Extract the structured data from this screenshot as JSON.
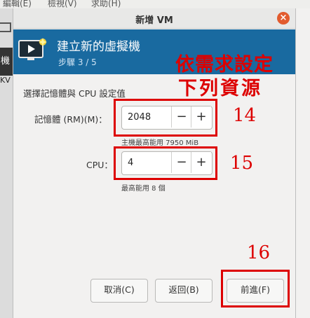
{
  "background": {
    "menu_items": [
      "編輯(E)",
      "檢視(V)",
      "求助(H)"
    ],
    "left_tab_label": "機",
    "left_sub_label": "KV"
  },
  "dialog": {
    "title": "新增 VM",
    "close_glyph": "×"
  },
  "header": {
    "title": "建立新的虛擬機",
    "step": "步驟 3 / 5",
    "icon": "monitor-play-icon"
  },
  "form": {
    "section_title": "選擇記憶體與 CPU 設定值",
    "memory": {
      "label": "記憶體 (RM)(M)：",
      "value": "2048",
      "hint": "主機最高能用 7950 MiB"
    },
    "cpu": {
      "label": "CPU：",
      "value": "4",
      "hint": "最高能用 8 個"
    },
    "minus_glyph": "−",
    "plus_glyph": "+"
  },
  "buttons": {
    "cancel": "取消(C)",
    "back": "返回(B)",
    "forward": "前進(F)"
  },
  "annotations": {
    "note_line1": "依需求設定",
    "note_line2": "下列資源",
    "num_memory": "14",
    "num_cpu": "15",
    "num_forward": "16",
    "color": "#dd0000"
  },
  "colors": {
    "header_bg": "#196aa0",
    "close_button": "#e25b2e",
    "annotation": "#dd0000"
  }
}
